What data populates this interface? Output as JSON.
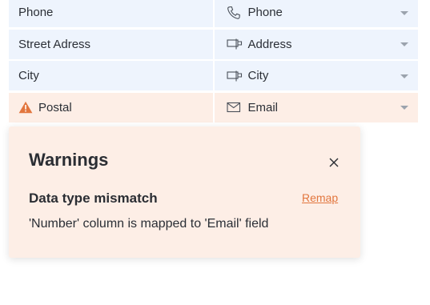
{
  "mapping_rows": [
    {
      "source": "Phone",
      "target": "Phone",
      "target_icon": "phone-icon",
      "status": "ok"
    },
    {
      "source": "Street Adress",
      "target": "Address",
      "target_icon": "address-field-icon",
      "status": "ok"
    },
    {
      "source": "City",
      "target": "City",
      "target_icon": "address-field-icon",
      "status": "ok"
    },
    {
      "source": "Postal",
      "target": "Email",
      "target_icon": "envelope-icon",
      "status": "warning"
    }
  ],
  "warnings_panel": {
    "title": "Warnings",
    "items": [
      {
        "title": "Data type mismatch",
        "action_label": "Remap",
        "description": "'Number' column is mapped to 'Email' field"
      }
    ]
  },
  "colors": {
    "row_background": "#eef4fd",
    "warning_background": "#fdeee6",
    "warning_accent": "#e2763e"
  }
}
